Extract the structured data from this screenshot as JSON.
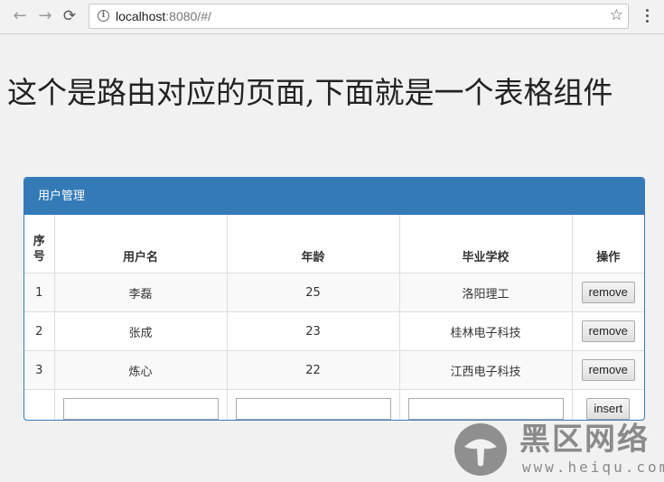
{
  "browser": {
    "url_host": "localhost",
    "url_rest": ":8080/#/",
    "back_glyph": "←",
    "forward_glyph": "→",
    "reload_glyph": "⟳",
    "star_glyph": "☆",
    "info_glyph": "i",
    "icons": [
      "back-icon",
      "forward-icon",
      "reload-icon",
      "info-icon",
      "star-icon",
      "menu-icon"
    ]
  },
  "page": {
    "title": "这个是路由对应的页面,下面就是一个表格组件"
  },
  "panel": {
    "heading": "用户管理",
    "accent_color": "#337ab7"
  },
  "table": {
    "headers": [
      "序号",
      "用户名",
      "年龄",
      "毕业学校",
      "操作"
    ],
    "rows": [
      {
        "index": "1",
        "username": "李磊",
        "age": "25",
        "school": "洛阳理工",
        "action": "remove"
      },
      {
        "index": "2",
        "username": "张成",
        "age": "23",
        "school": "桂林电子科技",
        "action": "remove"
      },
      {
        "index": "3",
        "username": "炼心",
        "age": "22",
        "school": "江西电子科技",
        "action": "remove"
      }
    ],
    "insert_row": {
      "username_value": "",
      "age_value": "",
      "school_value": "",
      "action": "insert"
    }
  },
  "watermark": {
    "brand": "黑区网络",
    "url": "www.heiqu.com"
  }
}
